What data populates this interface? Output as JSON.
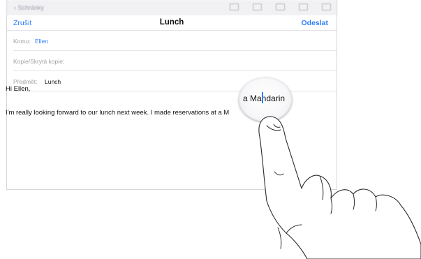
{
  "background_toolbar": {
    "back_label": "Schránky"
  },
  "navbar": {
    "cancel_label": "Zrušit",
    "title": "Lunch",
    "send_label": "Odeslat"
  },
  "fields": {
    "to_label": "Komu:",
    "to_value": "Ellen",
    "cc_label": "Kopie/Skrytá kopie:",
    "subject_label": "Předmět:",
    "subject_value": "Lunch"
  },
  "body": {
    "greeting": "Hi Ellen,",
    "paragraph": "I'm really looking forward to our lunch next week. I made reservations at a M"
  },
  "magnifier": {
    "text": "a Mandarin"
  },
  "colors": {
    "accent": "#2f7ef6",
    "text": "#111111",
    "muted": "#a1a1a6"
  }
}
